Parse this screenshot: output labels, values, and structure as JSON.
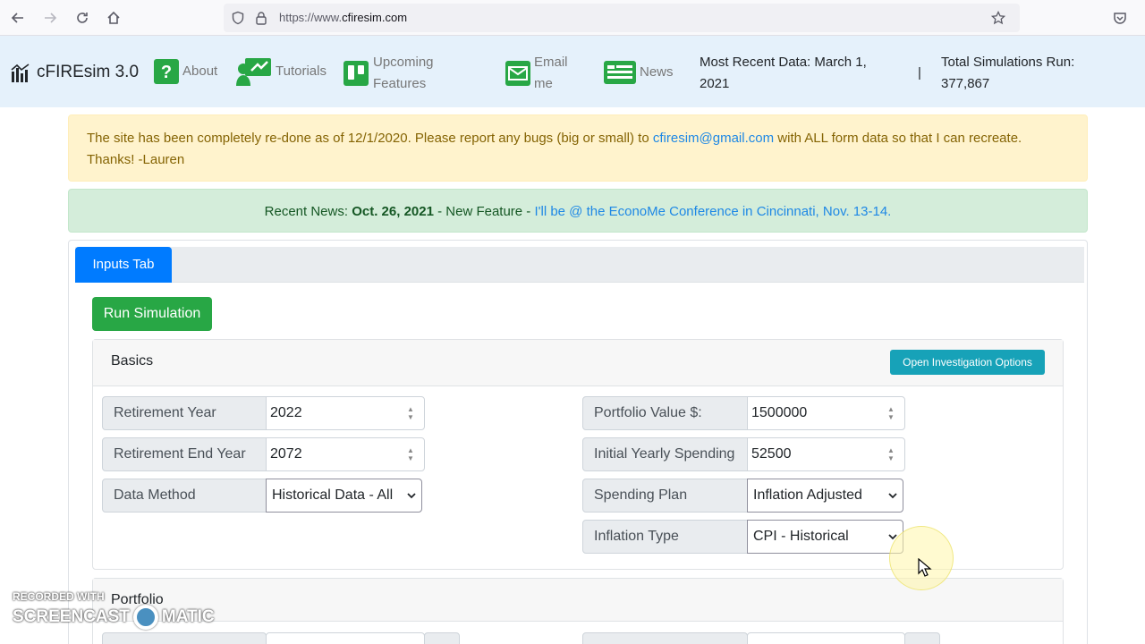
{
  "browser": {
    "url_prefix": "https://www.",
    "url_domain": "cfiresim.com"
  },
  "nav": {
    "brand": "cFIREsim 3.0",
    "about": "About",
    "tutorials": "Tutorials",
    "upcoming_line1": "Upcoming",
    "upcoming_line2": "Features",
    "email_line1": "Email",
    "email_line2": "me",
    "news": "News",
    "recent_data_line1": "Most Recent Data: March 1,",
    "recent_data_line2": "2021",
    "separator": "|",
    "sims_line1": "Total Simulations Run:",
    "sims_line2": "377,867"
  },
  "alert": {
    "text_before": "The site has been completely re-done as of 12/1/2020. Please report any bugs (big or small) to ",
    "email": "cfiresim@gmail.com",
    "text_after": " with ALL form data so that I can recreate. Thanks! -Lauren"
  },
  "news": {
    "prefix": "Recent News: ",
    "date": "Oct. 26, 2021",
    "middle": " - New Feature - ",
    "link": "I'll be @ the EconoMe Conference in Cincinnati, Nov. 13-14."
  },
  "tabs": {
    "inputs": "Inputs Tab"
  },
  "run_button": "Run Simulation",
  "basics": {
    "title": "Basics",
    "investigate_button": "Open Investigation Options",
    "retirement_year_label": "Retirement Year",
    "retirement_year": "2022",
    "retirement_end_label": "Retirement End Year",
    "retirement_end": "2072",
    "data_method_label": "Data Method",
    "data_method": "Historical Data - All",
    "portfolio_label": "Portfolio Value $:",
    "portfolio": "1500000",
    "spending_label": "Initial Yearly Spending",
    "spending": "52500",
    "spending_plan_label": "Spending Plan",
    "spending_plan": "Inflation Adjusted",
    "inflation_label": "Inflation Type",
    "inflation": "CPI - Historical"
  },
  "portfolio_section": {
    "title": "Portfolio"
  },
  "watermark": {
    "line1": "RECORDED WITH",
    "left": "SCREENCAST",
    "right": "MATIC"
  }
}
